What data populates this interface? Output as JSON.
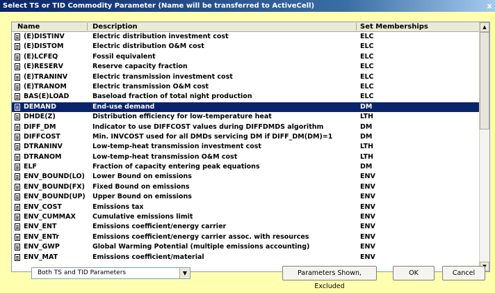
{
  "window": {
    "title": "Select TS or TID Commodity Parameter (Name will be transferred to ActiveCell)",
    "close_label": "x"
  },
  "table": {
    "columns": {
      "name": "Name",
      "description": "Description",
      "set": "Set Memberships"
    },
    "rows": [
      {
        "name": "(E)DISTINV",
        "description": "Electric distribution investment cost",
        "set": "ELC"
      },
      {
        "name": "(E)DISTOM",
        "description": "Electric distribution O&M cost",
        "set": "ELC"
      },
      {
        "name": "(E)LCFEQ",
        "description": "Fossil equivalent",
        "set": "ELC"
      },
      {
        "name": "(E)RESERV",
        "description": "Reserve capacity fraction",
        "set": "ELC"
      },
      {
        "name": "(E)TRANINV",
        "description": "Electric transmission investment cost",
        "set": "ELC"
      },
      {
        "name": "(E)TRANOM",
        "description": "Electric transmission O&M cost",
        "set": "ELC"
      },
      {
        "name": "BAS(E)LOAD",
        "description": "Baseload fraction of total night production",
        "set": "ELC"
      },
      {
        "name": "DEMAND",
        "description": "End-use demand",
        "set": "DM"
      },
      {
        "name": "DHDE(Z)",
        "description": "Distribution efficiency for low-temperature heat",
        "set": "LTH"
      },
      {
        "name": "DIFF_DM",
        "description": "Indicator to use DIFFCOST values during DIFFDMDS algorithm",
        "set": "DM"
      },
      {
        "name": "DIFFCOST",
        "description": "Min. INVCOST used for all DMDs servicing DM if DIFF_DM(DM)=1",
        "set": "DM"
      },
      {
        "name": "DTRANINV",
        "description": "Low-temp-heat transmission investment cost",
        "set": "LTH"
      },
      {
        "name": "DTRANOM",
        "description": "Low-temp-heat transmission O&M cost",
        "set": "LTH"
      },
      {
        "name": "ELF",
        "description": "Fraction of capacity entering peak equations",
        "set": "DM"
      },
      {
        "name": "ENV_BOUND(LO)",
        "description": "Lower Bound on emissions",
        "set": "ENV"
      },
      {
        "name": "ENV_BOUND(FX)",
        "description": "Fixed Bound on emissions",
        "set": "ENV"
      },
      {
        "name": "ENV_BOUND(UP)",
        "description": "Upper Bound on emissions",
        "set": "ENV"
      },
      {
        "name": "ENV_COST",
        "description": "Emissions tax",
        "set": "ENV"
      },
      {
        "name": "ENV_CUMMAX",
        "description": "Cumulative emissions limit",
        "set": "ENV"
      },
      {
        "name": "ENV_ENT",
        "description": "Emissions coefficient/energy carrier",
        "set": "ENV"
      },
      {
        "name": "ENV_ENTr",
        "description": "Emissions coefficient/energy carrier assoc. with resources",
        "set": "ENV"
      },
      {
        "name": "ENV_GWP",
        "description": "Global Warming Potential (multiple emissions accounting)",
        "set": "ENV"
      },
      {
        "name": "ENV_MAT",
        "description": "Emissions coefficient/material",
        "set": "ENV"
      }
    ],
    "selected_index": 7
  },
  "footer": {
    "filter_value": "Both TS and TID Parameters",
    "params_button": "Parameters Shown, Excluded",
    "ok_button": "OK",
    "cancel_button": "Cancel"
  },
  "icons": {
    "row_icon": "document-icon",
    "scroll_up": "scroll-up-arrow-icon",
    "scroll_down": "scroll-down-arrow-icon",
    "dropdown": "chevron-down-icon"
  },
  "colors": {
    "background": "#ffffa6",
    "selection": "#0a246a",
    "title_bar": "#0a246a"
  }
}
